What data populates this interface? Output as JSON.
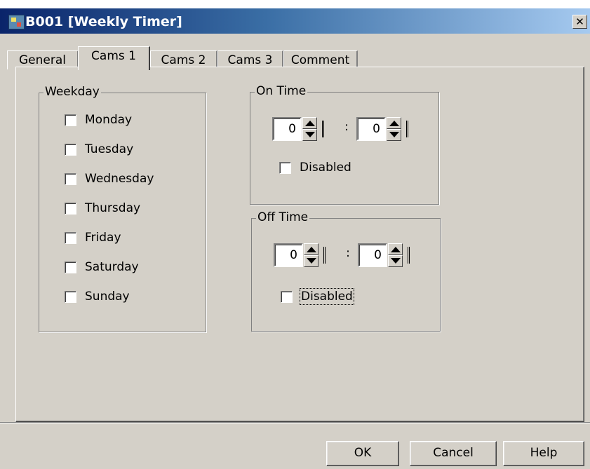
{
  "window": {
    "title": "B001 [Weekly Timer]",
    "close_glyph": "✕"
  },
  "tabs": [
    "General",
    "Cams 1",
    "Cams 2",
    "Cams 3",
    "Comment"
  ],
  "active_tab": "Cams 1",
  "weekday_group": {
    "legend": "Weekday",
    "days": [
      "Monday",
      "Tuesday",
      "Wednesday",
      "Thursday",
      "Friday",
      "Saturday",
      "Sunday"
    ]
  },
  "on_time": {
    "legend": "On Time",
    "hour": "0",
    "minute": "0",
    "separator": ":",
    "disabled_label": "Disabled"
  },
  "off_time": {
    "legend": "Off Time",
    "hour": "0",
    "minute": "0",
    "separator": ":",
    "disabled_label": "Disabled"
  },
  "buttons": {
    "ok": "OK",
    "cancel": "Cancel",
    "help": "Help"
  },
  "icons": {
    "app": "weekly-timer-icon",
    "close": "close-icon",
    "spin_up": "arrow-up-icon",
    "spin_down": "arrow-down-icon"
  }
}
